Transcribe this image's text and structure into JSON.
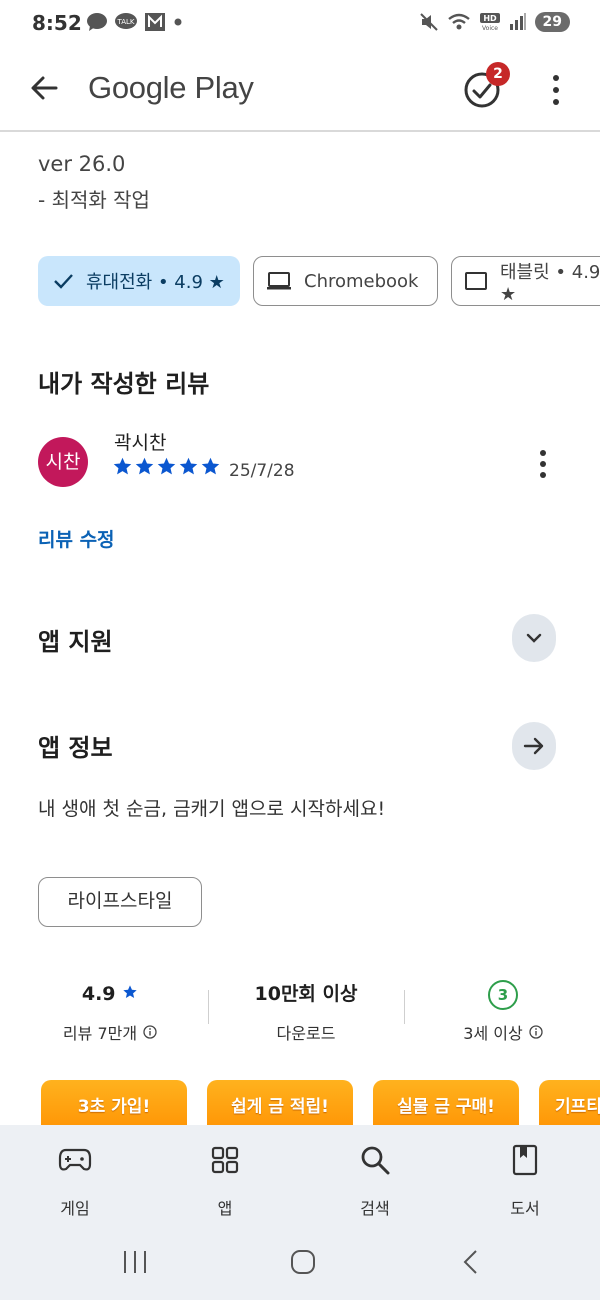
{
  "status_bar": {
    "time": "8:52",
    "battery": "29",
    "left_icons": [
      "message-bubble-icon",
      "kakaotalk-icon",
      "gmail-icon",
      "dot-icon"
    ],
    "right_icons": [
      "mute-icon",
      "wifi-icon",
      "hd-voice-icon",
      "signal-icon"
    ]
  },
  "app_bar": {
    "title": "Google Play",
    "notification_count": "2"
  },
  "whats_new": {
    "version": "ver 26.0",
    "note": "- 최적화 작업"
  },
  "device_chips": [
    {
      "label": "휴대전화 • 4.9 ★",
      "icon": "phone-check-icon",
      "selected": true
    },
    {
      "label": "Chromebook",
      "icon": "laptop-icon",
      "selected": false
    },
    {
      "label": "태블릿 • 4.9 ★",
      "icon": "tablet-icon",
      "selected": false
    }
  ],
  "my_review": {
    "title": "내가 작성한 리뷰",
    "avatar_text": "시찬",
    "avatar_color": "#c2185b",
    "reviewer": "곽시찬",
    "stars": 5,
    "date": "25/7/28",
    "edit_label": "리뷰 수정"
  },
  "app_support": {
    "title": "앱 지원"
  },
  "app_info": {
    "title": "앱 정보",
    "description": "내 생애 첫 순금, 금캐기 앱으로 시작하세요!",
    "category": "라이프스타일"
  },
  "stats": {
    "rating": "4.9",
    "reviews_label": "리뷰 7만개",
    "downloads": "10만회 이상",
    "downloads_label": "다운로드",
    "age_rating": "3",
    "age_label": "3세 이상"
  },
  "promos": [
    {
      "label": "3초 가입!"
    },
    {
      "label": "쉽게 금 적립!"
    },
    {
      "label": "실물 금 구매!"
    },
    {
      "label": "기프티"
    }
  ],
  "bottom_nav": [
    {
      "label": "게임",
      "icon": "gamepad-icon"
    },
    {
      "label": "앱",
      "icon": "apps-grid-icon"
    },
    {
      "label": "검색",
      "icon": "search-icon"
    },
    {
      "label": "도서",
      "icon": "book-icon"
    }
  ],
  "colors": {
    "accent_blue": "#0b62b5",
    "chip_selected_bg": "#c9e6fc",
    "star": "#0b57d0",
    "age_green": "#2e9e4b",
    "badge_red": "#c62828"
  }
}
